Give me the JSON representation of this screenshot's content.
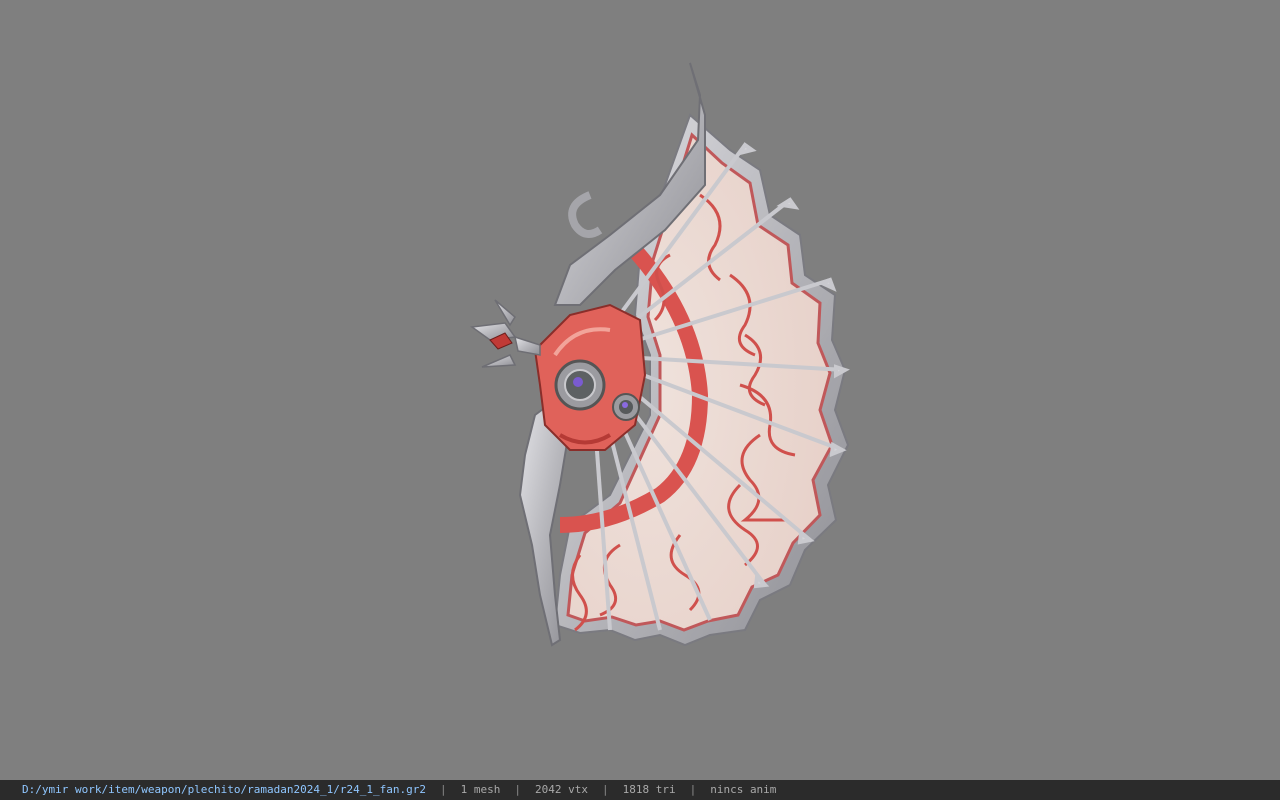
{
  "viewer": {
    "background_color": "#7f7f7f",
    "model_name": "fan",
    "model_icon": "war-fan-model"
  },
  "statusbar": {
    "file_path": "D:/ymir work/item/weapon/plechito/ramadan2024_1/r24_1_fan.gr2",
    "sep": "|",
    "mesh_count": "1 mesh",
    "vertex_count": "2042 vtx",
    "triangle_count": "1818 tri",
    "anim_status": "nincs anim",
    "colors": {
      "background": "#2b2b2b",
      "path": "#8fc6ff",
      "text": "#a9a9a9"
    }
  }
}
